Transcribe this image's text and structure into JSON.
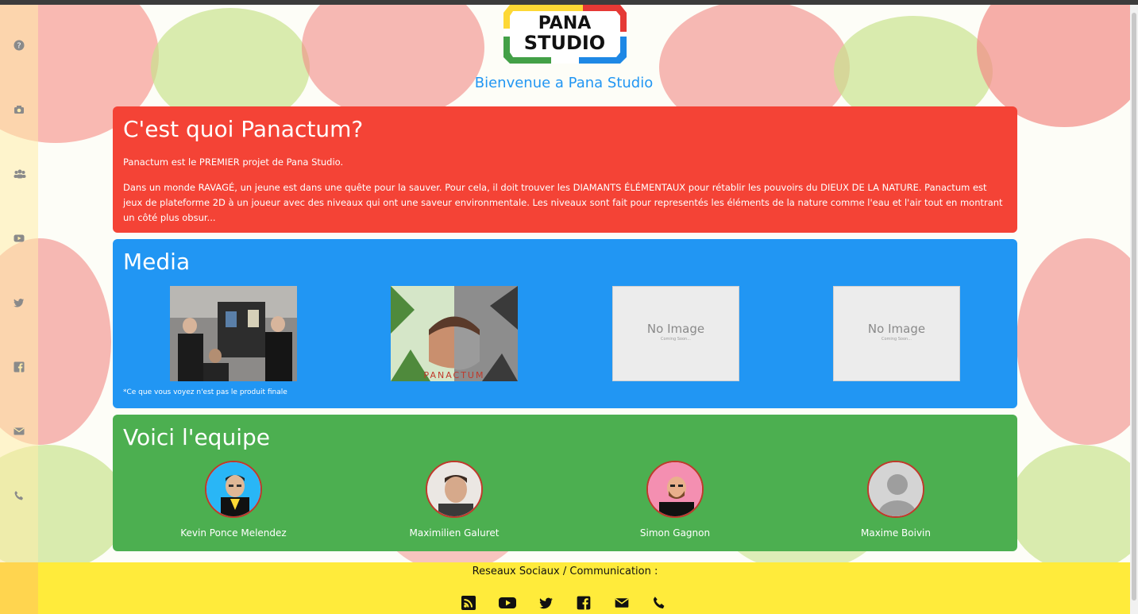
{
  "header": {
    "logo_line1": "PANA",
    "logo_line2": "STUDIO",
    "welcome": "Bienvenue a Pana Studio"
  },
  "sidebar": {
    "icons": [
      "question-icon",
      "camera-icon",
      "users-icon",
      "youtube-icon",
      "twitter-icon",
      "facebook-icon",
      "envelope-icon",
      "phone-icon"
    ]
  },
  "about": {
    "title": "C'est quoi Panactum?",
    "p1": "Panactum est le PREMIER projet de Pana Studio.",
    "p2": "Dans un monde RAVAGÉ, un jeune est dans une quête pour la sauver. Pour cela, il doit trouver les DIAMANTS ÉLÉMENTAUX pour rétablir les pouvoirs du DIEUX DE LA NATURE. Panactum est jeux de plateforme 2D à un joueur avec des niveaux qui ont une saveur environmentale. Les niveaux sont fait pour representés les éléments de la nature comme l'eau et l'air tout en montrant un côté plus obsur..."
  },
  "media": {
    "title": "Media",
    "items": [
      {
        "kind": "photo-team"
      },
      {
        "kind": "game-art",
        "label": "PANACTUM"
      },
      {
        "kind": "placeholder",
        "label": "No Image",
        "sub": "Coming Soon..."
      },
      {
        "kind": "placeholder",
        "label": "No Image",
        "sub": "Coming Soon..."
      }
    ],
    "note": "*Ce que vous voyez n'est pas le produit finale"
  },
  "team": {
    "title": "Voici l'equipe",
    "members": [
      {
        "name": "Kevin Ponce Melendez"
      },
      {
        "name": "Maximilien Galuret"
      },
      {
        "name": "Simon Gagnon"
      },
      {
        "name": "Maxime Boivin"
      }
    ]
  },
  "footer": {
    "label": "Reseaux Sociaux / Communication :",
    "icons": [
      "rss-icon",
      "youtube-icon",
      "twitter-icon",
      "facebook-icon",
      "envelope-icon",
      "phone-icon"
    ]
  },
  "colors": {
    "red": "#f44336",
    "blue": "#2196f3",
    "green": "#4caf50",
    "yellow": "#ffeb3b"
  }
}
